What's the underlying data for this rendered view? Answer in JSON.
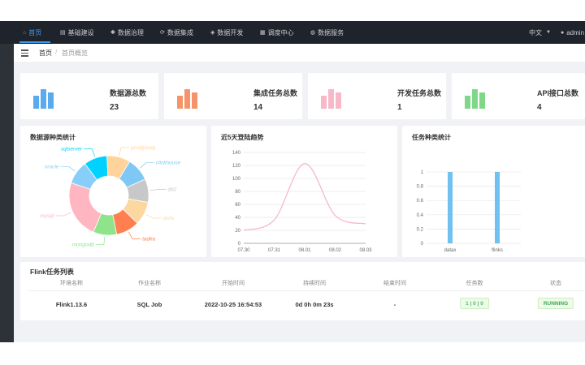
{
  "nav": {
    "items": [
      {
        "icon": "home-icon",
        "glyph": "⌂",
        "label": "首页",
        "active": true
      },
      {
        "icon": "document-icon",
        "glyph": "▤",
        "label": "基础建设"
      },
      {
        "icon": "gear-icon",
        "glyph": "✱",
        "label": "数据治理"
      },
      {
        "icon": "sync-icon",
        "glyph": "⟳",
        "label": "数据集成"
      },
      {
        "icon": "shield-icon",
        "glyph": "◈",
        "label": "数据开发"
      },
      {
        "icon": "calendar-icon",
        "glyph": "▦",
        "label": "调度中心"
      },
      {
        "icon": "service-icon",
        "glyph": "◍",
        "label": "数据服务"
      }
    ],
    "lang": "中文",
    "user": "admin"
  },
  "breadcrumb": {
    "home": "首页",
    "separator": "/",
    "current": "首页概览"
  },
  "stats": [
    {
      "label": "数据源总数",
      "value": "23",
      "color": "#5aaaf0"
    },
    {
      "label": "集成任务总数",
      "value": "14",
      "color": "#f5946a"
    },
    {
      "label": "开发任务总数",
      "value": "1",
      "color": "#f7b8c8"
    },
    {
      "label": "API接口总数",
      "value": "4",
      "color": "#7ed887"
    }
  ],
  "panels": {
    "datasource_title": "数据源种类统计",
    "trend_title": "近5天登陆趋势",
    "tasktype_title": "任务种类统计"
  },
  "chart_data": [
    {
      "type": "pie",
      "variant": "donut",
      "title": "数据源种类统计",
      "categories": [
        "clickhouse",
        "db2",
        "doris",
        "tadka",
        "mongodb",
        "mysql",
        "oracle",
        "sqlserver",
        "postgresql"
      ],
      "values": [
        2,
        2,
        2,
        2,
        2,
        5,
        2,
        2,
        2
      ],
      "colors": [
        "#7ec8f5",
        "#c8c8c8",
        "#fcd7a0",
        "#ff7f50",
        "#8fe38b",
        "#ffb6c1",
        "#87cefa",
        "#00d2ff",
        "#ffd39b"
      ]
    },
    {
      "type": "line",
      "title": "近5天登陆趋势",
      "x": [
        "07.30",
        "07.31",
        "08.01",
        "08.02",
        "08.03"
      ],
      "values": [
        20,
        36,
        123,
        43,
        30
      ],
      "ylim": [
        0,
        140
      ],
      "yticks": [
        0,
        20,
        40,
        60,
        80,
        100,
        120,
        140
      ],
      "grid": true,
      "color": "#f7b8c8"
    },
    {
      "type": "bar",
      "title": "任务种类统计",
      "categories": [
        "datax",
        "flinks"
      ],
      "values": [
        1,
        1
      ],
      "ylim": [
        0,
        1
      ],
      "yticks": [
        "0",
        "0.2",
        "0.4",
        "0.6",
        "0.8",
        "1"
      ],
      "grid": true,
      "color": "#70c0f0"
    }
  ],
  "table": {
    "title": "Flink任务列表",
    "headers": [
      "环境名称",
      "作业名称",
      "开始时间",
      "持续时间",
      "结束时间",
      "任务数",
      "状态"
    ],
    "row": {
      "env": "Flink1.13.6",
      "job": "SQL Job",
      "start": "2022-10-25 16:54:53",
      "duration": "0d 0h 0m 23s",
      "end": "-",
      "tasks": "1 | 0 | 0",
      "status": "RUNNING"
    }
  }
}
